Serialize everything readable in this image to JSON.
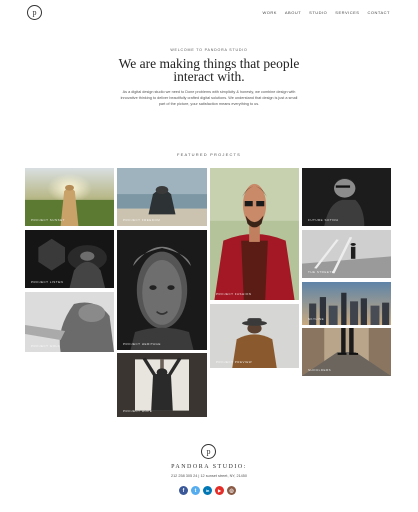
{
  "header": {
    "logo": "p",
    "nav": [
      "WORK",
      "ABOUT",
      "STUDIO",
      "SERVICES",
      "CONTACT"
    ]
  },
  "hero": {
    "eyebrow": "WELCOME TO PANDORA STUDIO",
    "title": "We are making things that people interact with.",
    "intro": "As a digital design studio we need to Done problems with simplicity & honesty, we combine design with innovative thinking to deliver beautifully crafted digital solutions. We understand that design is just a small part of the picture, your satisfaction means everything to us."
  },
  "projects": {
    "title": "FEATURED PROJECTS",
    "tiles": [
      {
        "caption": "PROJECT SUNSET"
      },
      {
        "caption": "PROJECT FREEDOM"
      },
      {
        "caption": "PROJECT FASHION"
      },
      {
        "caption": "FUTURE SOTIRA"
      },
      {
        "caption": "PROJECT LISTEN"
      },
      {
        "caption": "PROJECT HERITAGE"
      },
      {
        "caption": "THE STREETS"
      },
      {
        "caption": "PROJECT GOLD"
      },
      {
        "caption": "PROJECT PREVIEW"
      },
      {
        "caption": "SKYLINE"
      },
      {
        "caption": "PROJECT SKY"
      },
      {
        "caption": "SHOULDERS"
      },
      {
        "caption": "PROJECT HOPE"
      }
    ]
  },
  "footer": {
    "logo": "p",
    "name": "PANDORA STUDIO:",
    "address": "212 258 305 24 | 12 sunset street, NY, 21450",
    "socials": [
      {
        "icon": "facebook-icon",
        "glyph": "f",
        "color": "#3b5998"
      },
      {
        "icon": "twitter-icon",
        "glyph": "t",
        "color": "#55acee"
      },
      {
        "icon": "linkedin-icon",
        "glyph": "in",
        "color": "#0077b5"
      },
      {
        "icon": "youtube-icon",
        "glyph": "▶",
        "color": "#e52d27"
      },
      {
        "icon": "instagram-icon",
        "glyph": "◎",
        "color": "#8a5a44"
      }
    ]
  }
}
